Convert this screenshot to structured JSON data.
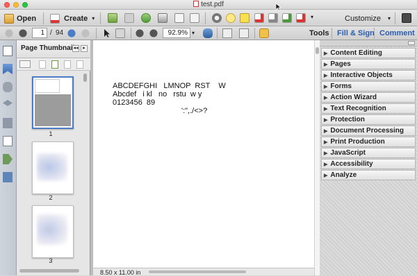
{
  "window": {
    "title": "test.pdf"
  },
  "toolbar": {
    "open_label": "Open",
    "create_label": "Create",
    "create_caret": "▾",
    "more_caret": "▾",
    "customize_label": "Customize",
    "customize_caret": "▾",
    "icons": [
      "create-pdf-icon",
      "save-icon",
      "cloud-upload-icon",
      "print-icon",
      "edit-icon",
      "email-icon",
      "gear-icon",
      "comment-icon",
      "highlight-icon",
      "delete-page-icon",
      "extract-page-icon",
      "insert-page-icon",
      "redact-icon"
    ]
  },
  "nav": {
    "current_page": "1",
    "page_separator": "/",
    "total_pages": "94",
    "zoom": "92.9%",
    "zoom_caret": "▾",
    "tabs": {
      "tools": "Tools",
      "fill_sign": "Fill & Sign",
      "comment": "Comment"
    }
  },
  "thumbnails": {
    "title": "Page Thumbnails",
    "pages": [
      {
        "label": "1"
      },
      {
        "label": "2"
      },
      {
        "label": "3"
      }
    ]
  },
  "document": {
    "lines": [
      "ABCDEFGHI   LMNOP  RST    W",
      "Abcdef   i kl   no   rstu  w y",
      "0123456  89",
      "':\",./<>?"
    ],
    "page_size": "8.50 x 11.00 in"
  },
  "tools_panel": {
    "sections": [
      "Content Editing",
      "Pages",
      "Interactive Objects",
      "Forms",
      "Action Wizard",
      "Text Recognition",
      "Protection",
      "Document Processing",
      "Print Production",
      "JavaScript",
      "Accessibility",
      "Analyze"
    ]
  },
  "colors": {
    "accent": "#2a5db0",
    "title_text": "#333333"
  }
}
